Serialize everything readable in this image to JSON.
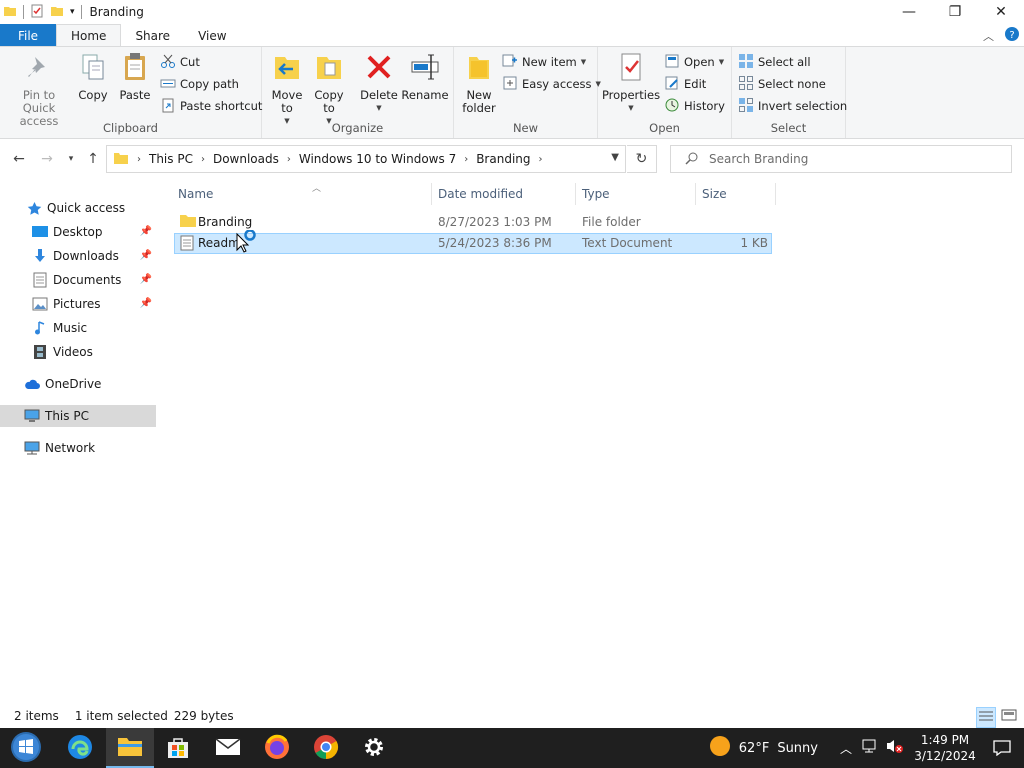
{
  "window": {
    "title": "Branding",
    "controls": {
      "minimize": "—",
      "maximize": "❐",
      "close": "✕"
    }
  },
  "ribbon_tabs": [
    "File",
    "Home",
    "Share",
    "View"
  ],
  "ribbon": {
    "clipboard": {
      "label": "Clipboard",
      "pin_to_quick_access": "Pin to Quick access",
      "copy": "Copy",
      "paste": "Paste",
      "cut": "Cut",
      "copy_path": "Copy path",
      "paste_shortcut": "Paste shortcut"
    },
    "organize": {
      "label": "Organize",
      "move_to": "Move to",
      "copy_to": "Copy to",
      "delete": "Delete",
      "rename": "Rename"
    },
    "new": {
      "label": "New",
      "new_folder": "New folder",
      "new_item": "New item",
      "easy_access": "Easy access"
    },
    "open": {
      "label": "Open",
      "properties": "Properties",
      "open": "Open",
      "edit": "Edit",
      "history": "History"
    },
    "select": {
      "label": "Select",
      "select_all": "Select all",
      "select_none": "Select none",
      "invert_selection": "Invert selection"
    }
  },
  "address": {
    "crumbs": [
      "This PC",
      "Downloads",
      "Windows 10 to Windows 7",
      "Branding"
    ]
  },
  "search": {
    "placeholder": "Search Branding"
  },
  "navpane": {
    "quick_access": "Quick access",
    "desktop": "Desktop",
    "downloads": "Downloads",
    "documents": "Documents",
    "pictures": "Pictures",
    "music": "Music",
    "videos": "Videos",
    "onedrive": "OneDrive",
    "this_pc": "This PC",
    "network": "Network"
  },
  "columns": {
    "name": "Name",
    "date_modified": "Date modified",
    "type": "Type",
    "size": "Size"
  },
  "files": [
    {
      "name": "Branding",
      "date": "8/27/2023 1:03 PM",
      "type": "File folder",
      "size": ""
    },
    {
      "name": "Readm",
      "date": "5/24/2023 8:36 PM",
      "type": "Text Document",
      "size": "1 KB"
    }
  ],
  "status": {
    "items": "2 items",
    "selected": "1 item selected",
    "bytes": "229 bytes"
  },
  "taskbar": {
    "weather_temp": "62°F",
    "weather_desc": "Sunny",
    "time": "1:49 PM",
    "date": "3/12/2024"
  },
  "colors": {
    "accent": "#1979ca",
    "selection": "#cce8ff",
    "taskbar": "#1f1f1f"
  }
}
